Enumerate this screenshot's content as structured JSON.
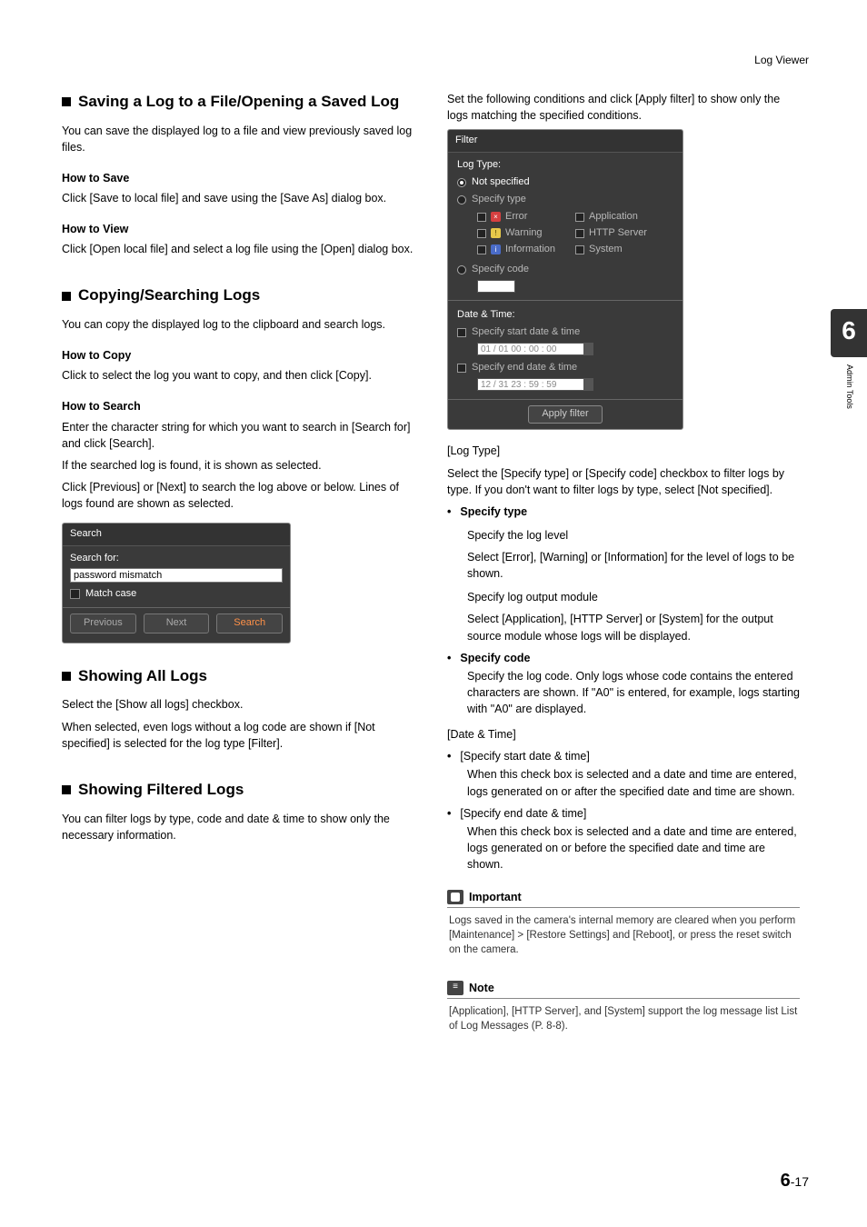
{
  "header": {
    "breadcrumb": "Log Viewer"
  },
  "sidetab": {
    "chapter": "6",
    "label": "Admin Tools"
  },
  "footer": {
    "chapter": "6",
    "sep": "-",
    "page": "17"
  },
  "left": {
    "s1": {
      "heading": "Saving a Log to a File/Opening a Saved Log",
      "intro": "You can save the displayed log to a file and view previously saved log files.",
      "save_h": "How to Save",
      "save_p": "Click [Save to local file] and save using the [Save As] dialog box.",
      "view_h": "How to View",
      "view_p": "Click [Open local file] and select a log file using the [Open] dialog box."
    },
    "s2": {
      "heading": "Copying/Searching Logs",
      "intro": "You can copy the displayed log to the clipboard and search logs.",
      "copy_h": "How to Copy",
      "copy_p": "Click to select the log you want to copy, and then click [Copy].",
      "search_h": "How to Search",
      "search_p1": "Enter the character string for which you want to search in [Search for] and click [Search].",
      "search_p2": "If the searched log is found, it is shown as selected.",
      "search_p3": "Click [Previous] or [Next] to search the log above or below. Lines of logs found are shown as selected."
    },
    "search_panel": {
      "title": "Search",
      "label": "Search for:",
      "value": "password mismatch",
      "match": "Match case",
      "prev": "Previous",
      "next": "Next",
      "search": "Search"
    },
    "s3": {
      "heading": "Showing All Logs",
      "p1": "Select the [Show all logs] checkbox.",
      "p2": "When selected, even logs without a log code are shown if [Not specified] is selected for the log type [Filter]."
    },
    "s4": {
      "heading": "Showing Filtered Logs",
      "p": "You can filter logs by type, code and date & time to show only the necessary information."
    }
  },
  "right": {
    "intro": "Set the following conditions and click [Apply filter] to show only the logs matching the specified conditions.",
    "filter_panel": {
      "title": "Filter",
      "logtype": "Log Type:",
      "not_spec": "Not specified",
      "spec_type": "Specify type",
      "err": "Error",
      "app": "Application",
      "warn": "Warning",
      "http": "HTTP Server",
      "info": "Information",
      "sys": "System",
      "spec_code": "Specify code",
      "dt": "Date & Time:",
      "start": "Specify start date & time",
      "start_v": "01 / 01 00 : 00 : 00",
      "end": "Specify end date & time",
      "end_v": "12 / 31 23 : 59 : 59",
      "apply": "Apply filter"
    },
    "logtype_h": "[Log Type]",
    "logtype_p": "Select the [Specify type] or [Specify code] checkbox to filter logs by type. If you don't want to filter logs by type, select [Not specified].",
    "spec_type_b": "Specify type",
    "spec_type_s1h": "Specify the log level",
    "spec_type_s1p": "Select [Error], [Warning] or [Information] for the level of logs to be shown.",
    "spec_type_s2h": "Specify log output module",
    "spec_type_s2p": "Select [Application], [HTTP Server] or [System] for the output source module whose logs will be displayed.",
    "spec_code_b": "Specify code",
    "spec_code_p": "Specify the log code. Only logs whose code contains the entered characters are shown. If \"A0\" is entered, for example, logs starting with \"A0\" are displayed.",
    "dt_h": "[Date & Time]",
    "dt_start_b": "[Specify start date & time]",
    "dt_start_p": "When this check box is selected and a date and time are entered, logs generated on or after the specified date and time are shown.",
    "dt_end_b": "[Specify end date & time]",
    "dt_end_p": "When this check box is selected and a date and time are entered, logs generated on or before the specified date and time are shown.",
    "important_h": "Important",
    "important_p": "Logs saved in the camera's internal memory are cleared when you perform [Maintenance] > [Restore Settings] and [Reboot], or press the reset switch on the camera.",
    "note_h": "Note",
    "note_p": "[Application], [HTTP Server], and [System] support the log message list List of Log Messages (P. 8-8)."
  }
}
